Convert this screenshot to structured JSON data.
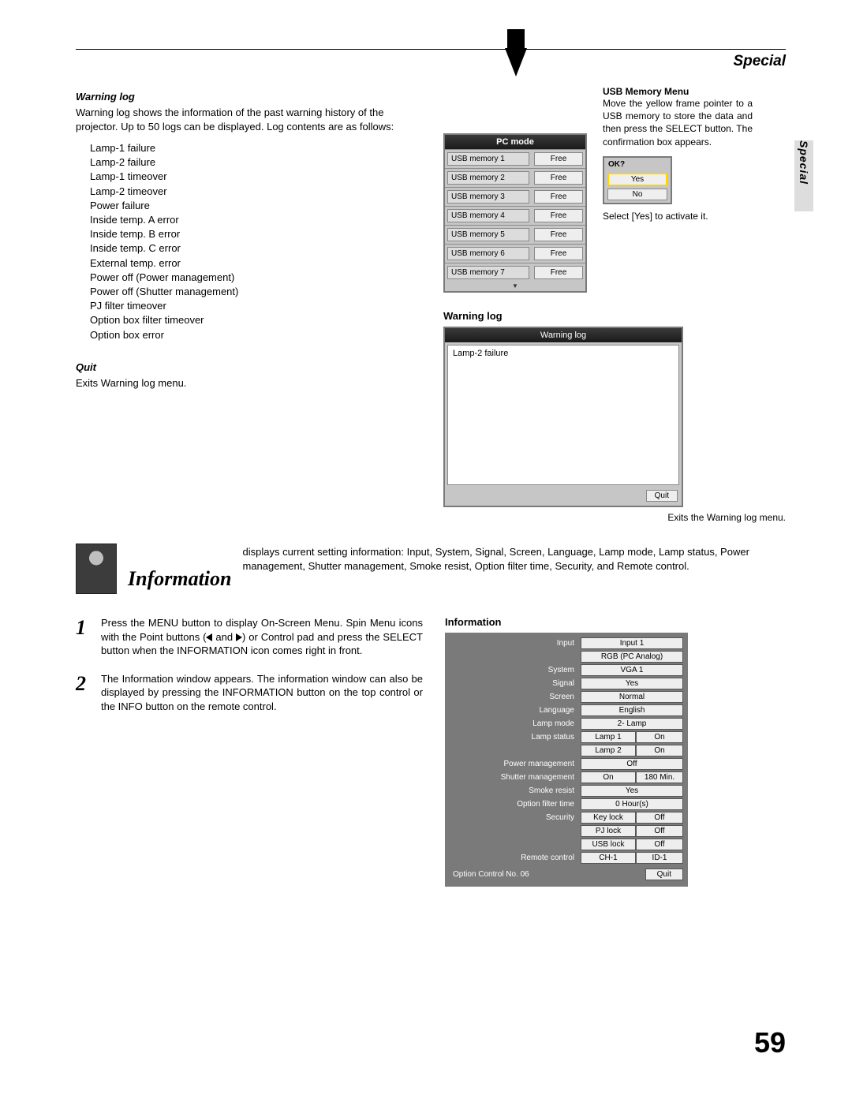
{
  "header": {
    "section": "Special",
    "side_tab": "Special"
  },
  "warning_log_section": {
    "heading": "Warning log",
    "intro": "Warning log shows the information of the past warning history of the projector.  Up to 50 logs can be displayed. Log contents are as follows:",
    "items": [
      "Lamp-1 failure",
      "Lamp-2 failure",
      "Lamp-1 timeover",
      "Lamp-2 timeover",
      "Power failure",
      "Inside temp. A error",
      "Inside temp. B error",
      "Inside temp. C error",
      "External temp. error",
      "Power off (Power management)",
      "Power off (Shutter management)",
      "PJ filter timeover",
      "Option box filter timeover",
      "Option box error"
    ],
    "quit_heading": "Quit",
    "quit_text": "Exits Warning log menu."
  },
  "pc_menu": {
    "title": "PC  mode",
    "rows": [
      {
        "label": "USB memory 1",
        "value": "Free"
      },
      {
        "label": "USB memory 2",
        "value": "Free"
      },
      {
        "label": "USB memory 3",
        "value": "Free"
      },
      {
        "label": "USB memory 4",
        "value": "Free"
      },
      {
        "label": "USB memory 5",
        "value": "Free"
      },
      {
        "label": "USB memory 6",
        "value": "Free"
      },
      {
        "label": "USB memory 7",
        "value": "Free"
      }
    ]
  },
  "usb_memory": {
    "heading": "USB Memory Menu",
    "text": "Move the yellow frame pointer to a USB memory to store the data and then press the SELECT button. The confirmation box appears.",
    "ok_label": "OK?",
    "yes": "Yes",
    "no": "No",
    "footer": "Select [Yes] to activate it."
  },
  "warning_log_window": {
    "section_label": "Warning log",
    "title": "Warning log",
    "entry": "Lamp-2 failure",
    "quit": "Quit",
    "caption": "Exits the Warning log menu."
  },
  "information": {
    "title": "Information",
    "desc": "displays current setting information: Input, System, Signal, Screen, Language, Lamp mode, Lamp status, Power management, Shutter management, Smoke resist, Option filter time, Security, and Remote control.",
    "step1a": "Press the MENU button to display On-Screen Menu. Spin Menu icons with the Point buttons (",
    "step1b": " and ",
    "step1c": ") or Control pad and press the SELECT button when the INFORMATION icon comes right in front.",
    "step2": "The Information window appears. The information window can also be displayed by pressing the INFORMATION button on the top control or the INFO button on the remote control.",
    "panel_label": "Information"
  },
  "info_panel": {
    "rows_single": [
      {
        "label": "Input",
        "value": "Input 1"
      },
      {
        "label": "",
        "value": "RGB (PC Analog)"
      },
      {
        "label": "System",
        "value": "VGA 1"
      },
      {
        "label": "Signal",
        "value": "Yes"
      },
      {
        "label": "Screen",
        "value": "Normal"
      },
      {
        "label": "Language",
        "value": "English"
      },
      {
        "label": "Lamp mode",
        "value": "2- Lamp"
      }
    ],
    "lamp_status_label": "Lamp status",
    "lamp_status": [
      {
        "a": "Lamp 1",
        "b": "On"
      },
      {
        "a": "Lamp 2",
        "b": "On"
      }
    ],
    "power_mgmt": {
      "label": "Power management",
      "value": "Off"
    },
    "shutter": {
      "label": "Shutter management",
      "a": "On",
      "b": "180 Min."
    },
    "smoke": {
      "label": "Smoke resist",
      "value": "Yes"
    },
    "opt_filter": {
      "label": "Option filter time",
      "value": "0 Hour(s)"
    },
    "security_label": "Security",
    "security": [
      {
        "a": "Key lock",
        "b": "Off"
      },
      {
        "a": "PJ lock",
        "b": "Off"
      },
      {
        "a": "USB lock",
        "b": "Off"
      }
    ],
    "remote": {
      "label": "Remote control",
      "a": "CH-1",
      "b": "ID-1"
    },
    "option_control": "Option Control No.  06",
    "quit": "Quit"
  },
  "page_number": "59"
}
